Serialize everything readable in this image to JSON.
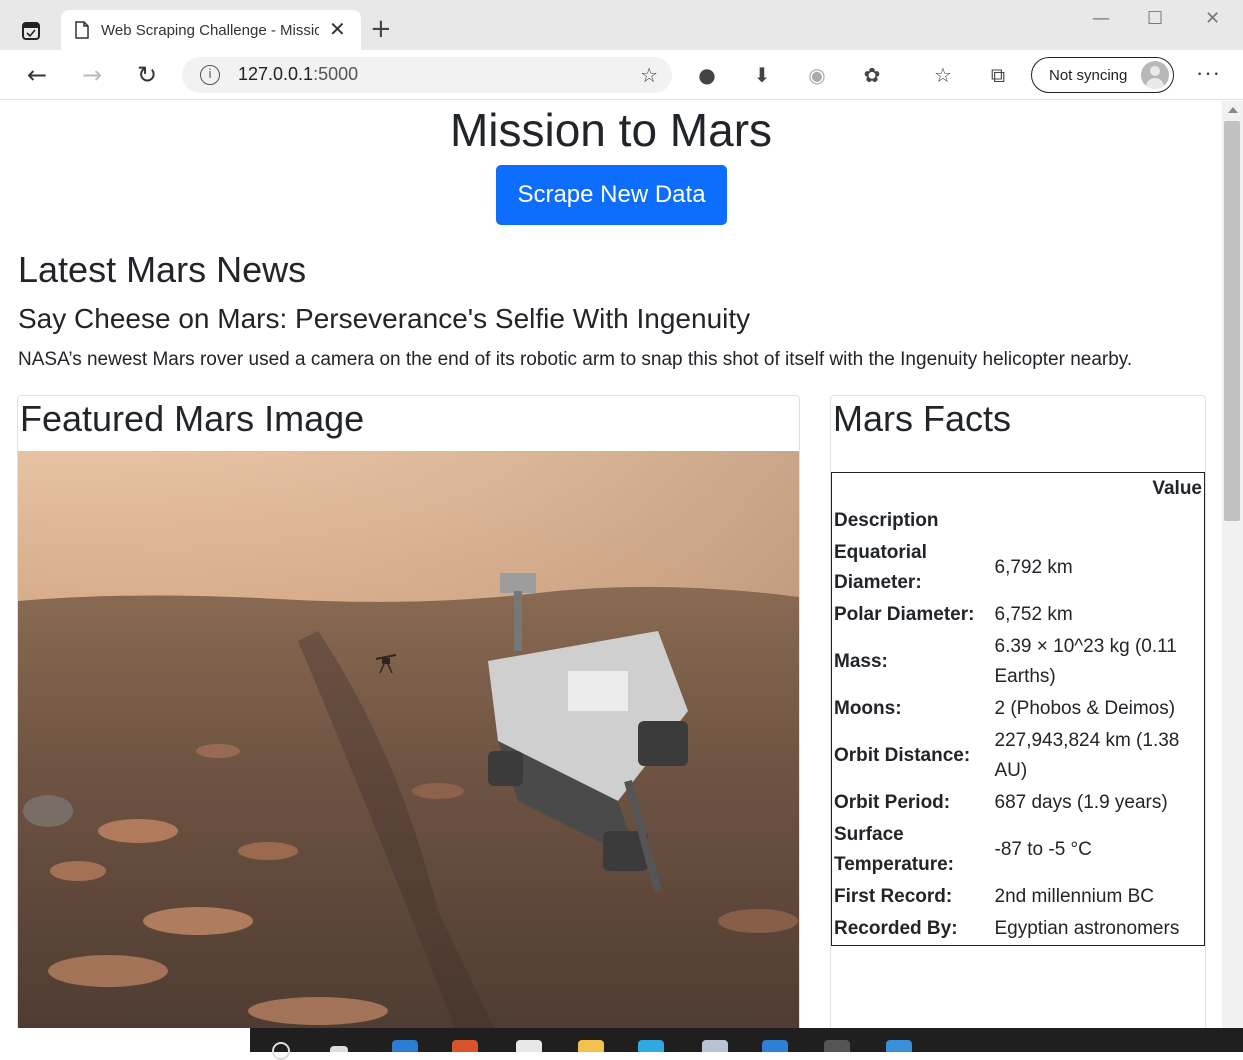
{
  "browser": {
    "tab_title": "Web Scraping Challenge - Mission to Mars",
    "new_tab_symbol": "+",
    "close_symbol": "✕",
    "address_host": "127.0.0.1",
    "address_port": ":5000",
    "profile_label": "Not syncing",
    "more_symbol": "···",
    "window_min": "—",
    "window_max": "☐",
    "window_close": "✕"
  },
  "page": {
    "title": "Mission to Mars",
    "scrape_button": "Scrape New Data",
    "news_heading": "Latest Mars News",
    "news_title": "Say Cheese on Mars: Perseverance's Selfie With Ingenuity",
    "news_paragraph": "NASA’s newest Mars rover used a camera on the end of its robotic arm to snap this shot of itself with the Ingenuity helicopter nearby.",
    "image_heading": "Featured Mars Image",
    "facts_heading": "Mars Facts",
    "facts_table": {
      "value_header": "Value",
      "index_header": "Description",
      "rows": [
        {
          "label": "Equatorial Diameter:",
          "value": "6,792 km"
        },
        {
          "label": "Polar Diameter:",
          "value": "6,752 km"
        },
        {
          "label": "Mass:",
          "value": "6.39 × 10^23 kg (0.11 Earths)"
        },
        {
          "label": "Moons:",
          "value": "2 (Phobos & Deimos)"
        },
        {
          "label": "Orbit Distance:",
          "value": "227,943,824 km (1.38 AU)"
        },
        {
          "label": "Orbit Period:",
          "value": "687 days (1.9 years)"
        },
        {
          "label": "Surface Temperature:",
          "value": "-87 to -5 °C"
        },
        {
          "label": "First Record:",
          "value": "2nd millennium BC"
        },
        {
          "label": "Recorded By:",
          "value": "Egyptian astronomers"
        }
      ]
    }
  },
  "colors": {
    "primary_button": "#0d6efd",
    "tabbar_bg": "#e8e8e8"
  }
}
